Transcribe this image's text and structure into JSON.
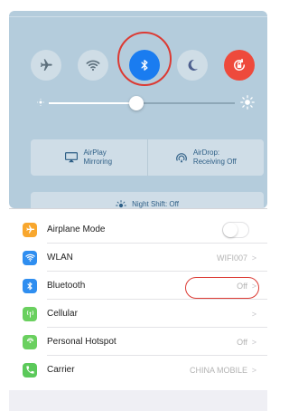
{
  "control_center": {
    "toggles": [
      {
        "name": "airplane",
        "icon": "airplane-icon",
        "state": "off"
      },
      {
        "name": "wifi",
        "icon": "wifi-icon",
        "state": "off"
      },
      {
        "name": "bluetooth",
        "icon": "bluetooth-icon",
        "state": "on"
      },
      {
        "name": "do_not_disturb",
        "icon": "moon-icon",
        "state": "off"
      },
      {
        "name": "rotation_lock",
        "icon": "rotation-lock-icon",
        "state": "on"
      }
    ],
    "brightness_level": 0.47,
    "airplay": {
      "line1": "AirPlay",
      "line2": "Mirroring"
    },
    "airdrop": {
      "line1": "AirDrop:",
      "line2": "Receiving Off"
    },
    "night_shift": "Night Shift: Off"
  },
  "settings": {
    "rows": [
      {
        "label": "Airplane Mode",
        "icon": "airplane-icon",
        "icon_color": "#f8a72e",
        "type": "switch",
        "switch_on": false
      },
      {
        "label": "WLAN",
        "icon": "wifi-icon",
        "icon_color": "#2f8ef0",
        "value": "WIFI007"
      },
      {
        "label": "Bluetooth",
        "icon": "bluetooth-icon",
        "icon_color": "#2f8ef0",
        "value": "Off"
      },
      {
        "label": "Cellular",
        "icon": "cellular-icon",
        "icon_color": "#6ad05f",
        "value": ""
      },
      {
        "label": "Personal Hotspot",
        "icon": "hotspot-icon",
        "icon_color": "#6ad05f",
        "value": "Off"
      },
      {
        "label": "Carrier",
        "icon": "phone-icon",
        "icon_color": "#5bc95a",
        "value": "CHINA MOBILE"
      }
    ]
  },
  "colors": {
    "highlight": "#dc3a33",
    "accent": "#1a7cf0"
  }
}
